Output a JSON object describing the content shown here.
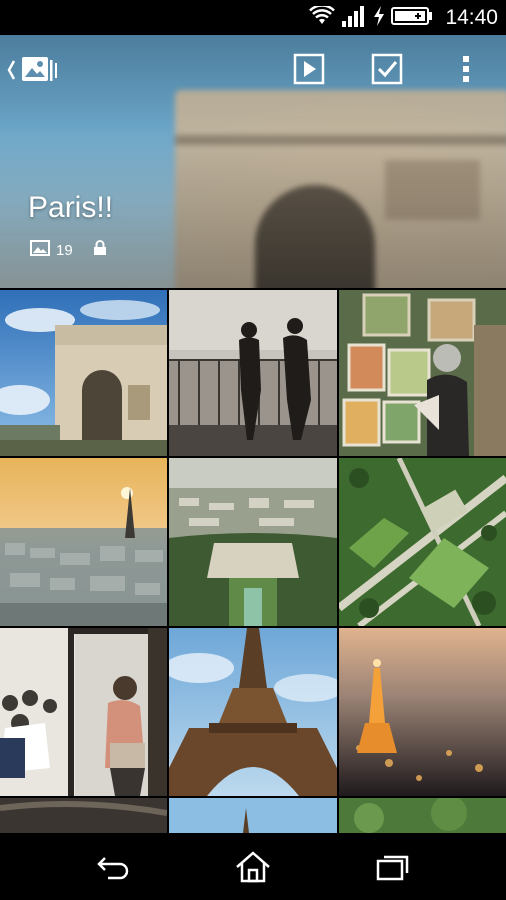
{
  "status_bar": {
    "time": "14:40",
    "icons": [
      "wifi-icon",
      "signal-icon",
      "charging-icon",
      "battery-icon"
    ]
  },
  "album_header": {
    "back_icon": "album-back-icon",
    "title": "Paris!!",
    "item_count": "19",
    "count_icon": "image-count-icon",
    "privacy_icon": "lock-icon",
    "actions": [
      "slideshow-play-icon",
      "select-checkbox-icon",
      "overflow-menu-icon"
    ]
  },
  "photos": [
    {
      "subject": "Arc de Triomphe"
    },
    {
      "subject": "Couple on observation deck"
    },
    {
      "subject": "Artist with paintings"
    },
    {
      "subject": "Sunset skyline with Eiffel Tower"
    },
    {
      "subject": "Trocadero gardens aerial"
    },
    {
      "subject": "Champ de Mars aerial"
    },
    {
      "subject": "Woman at cafe"
    },
    {
      "subject": "Eiffel Tower from below"
    },
    {
      "subject": "Eiffel Tower at night"
    },
    {
      "subject": "Thumbnail partial 1"
    },
    {
      "subject": "Thumbnail partial 2"
    },
    {
      "subject": "Thumbnail partial 3"
    }
  ],
  "nav_bar": [
    "back-nav-icon",
    "home-nav-icon",
    "recents-nav-icon"
  ]
}
